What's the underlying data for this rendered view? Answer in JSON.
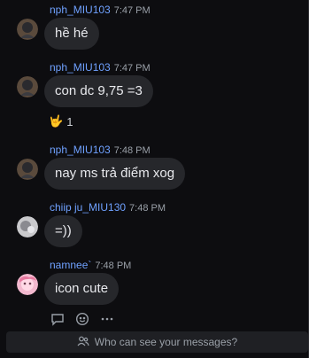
{
  "messages": [
    {
      "sender": "nph_MIU103",
      "time": "7:47 PM",
      "text": "hề hé"
    },
    {
      "sender": "nph_MIU103",
      "time": "7:47 PM",
      "text": "con dc 9,75 =3"
    },
    {
      "sender": "nph_MIU103",
      "time": "7:48 PM",
      "text": "nay ms trả điểm xog"
    },
    {
      "sender": "chiip ju_MIU130",
      "time": "7:48 PM",
      "text": "=))"
    },
    {
      "sender": "namnee`",
      "time": "7:48 PM",
      "text": "icon cute"
    }
  ],
  "reaction": {
    "emoji": "🤟",
    "count": "1"
  },
  "actions": {
    "icons": [
      "reply-icon",
      "emoji-react-icon",
      "more-icon"
    ]
  },
  "footer": {
    "text": "Who can see your messages?",
    "icon": "people-icon"
  },
  "colors": {
    "background": "#0d0d10",
    "bubble": "#26272b",
    "sender": "#6fa1ff",
    "muted": "#9aa0a8"
  }
}
